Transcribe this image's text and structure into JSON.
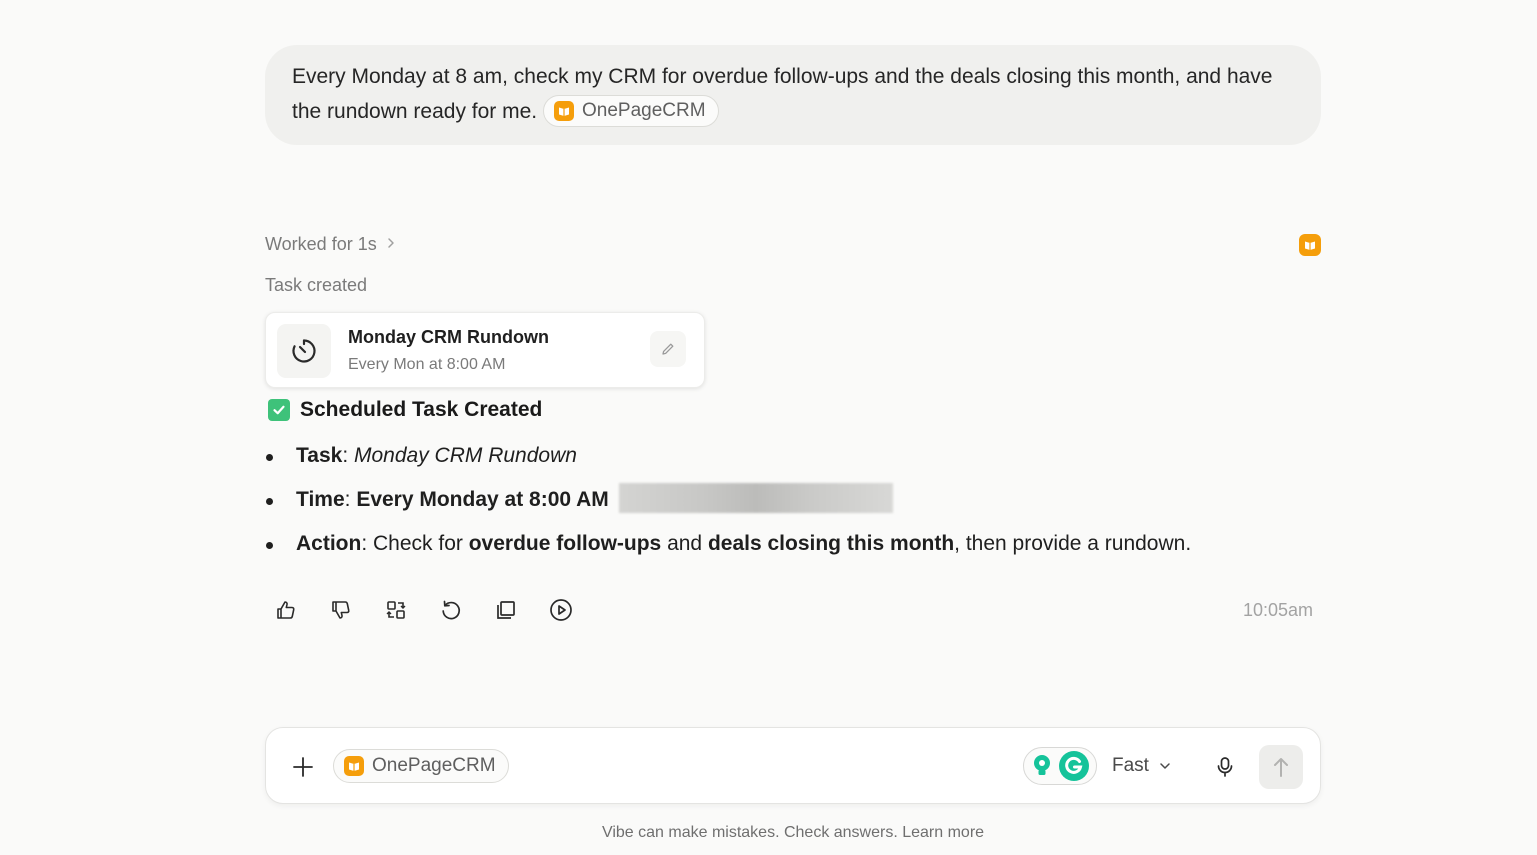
{
  "user_message": {
    "text": "Every Monday at 8 am, check my CRM for overdue follow-ups and the deals closing this month, and have the rundown ready for me.",
    "app_chip": "OnePageCRM"
  },
  "assistant": {
    "worked_label": "Worked for 1s",
    "task_created_label": "Task created",
    "task_card": {
      "title": "Monday CRM Rundown",
      "schedule": "Every Mon at 8:00 AM"
    },
    "heading": "Scheduled Task Created",
    "details": {
      "task_label": "Task",
      "task_value": "Monday CRM Rundown",
      "time_label": "Time",
      "time_value": "Every Monday at 8:00 AM",
      "action_label": "Action",
      "action_prefix": "Check for",
      "action_bold_1": "overdue follow-ups",
      "action_and": "and",
      "action_bold_2": "deals closing this month",
      "action_suffix": ", then provide a rundown."
    },
    "timestamp": "10:05am"
  },
  "composer": {
    "app_chip": "OnePageCRM",
    "mode_label": "Fast"
  },
  "disclaimer": "Vibe can make mistakes. Check answers. Learn more",
  "colors": {
    "app_logo": "#f59e0b",
    "check": "#3ec27a",
    "grammarly_green": "#15c39a"
  }
}
